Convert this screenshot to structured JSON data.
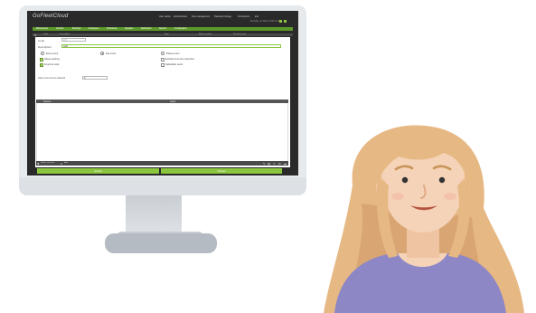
{
  "app": {
    "logo_main": "GoFleetCloud",
    "topbar": [
      "User: admin",
      "Administration",
      "Fleet management",
      "Password change",
      "Permissions",
      "Exit"
    ],
    "date": "Thursday, 12 March 2020 11:42",
    "menu": [
      "Maintenance",
      "Vehicles",
      "Bookings",
      "Employees",
      "Workshops",
      "Suppliers",
      "Dashboard",
      "Reports",
      "Configuration"
    ],
    "columns": [
      "Code",
      "Description",
      "Type",
      "Allows parking",
      "Found at work"
    ]
  },
  "dialog": {
    "code_label": "Code",
    "code_value": "4-5",
    "description_label": "Description",
    "description_value": "asdf",
    "event_types": [
      "Entry event",
      "Exit event",
      "Phase event"
    ],
    "selected_event": 1,
    "checkboxes": [
      {
        "label": "Allows parking",
        "checked": true
      },
      {
        "label": "Exclude time from total time",
        "checked": false
      },
      {
        "label": "Found at work",
        "checked": true
      },
      {
        "label": "Selectable event",
        "checked": false
      }
    ],
    "daily_label": "Daily occurrences allowed",
    "daily_value": "0",
    "grid_columns": [
      "Reason",
      "Active"
    ],
    "footer_left": [
      "Delete selected",
      "Add"
    ],
    "accept_label": "Accept",
    "cancel_label": "Cancel"
  },
  "colors": {
    "accent": "#8cc63f",
    "menubar": "#5e9a2b",
    "skin": "#f5d3b8",
    "hair": "#e6b883",
    "shirt": "#8d87c6"
  }
}
